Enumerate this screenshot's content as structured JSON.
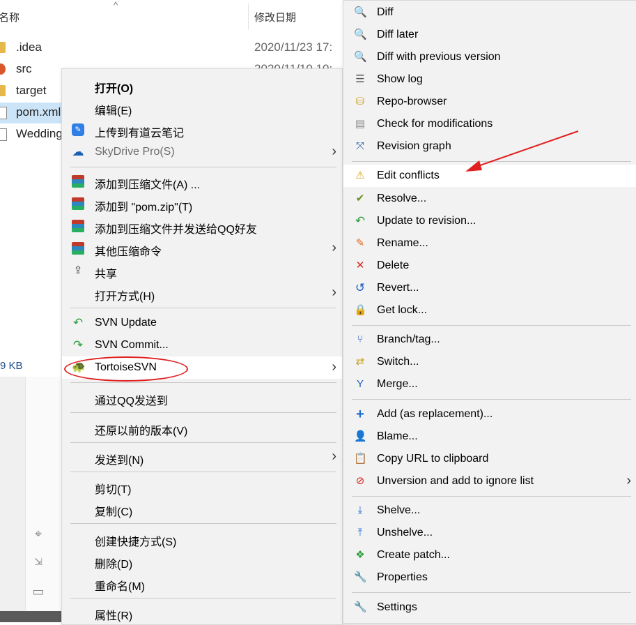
{
  "explorer": {
    "col_name": "名称",
    "col_date": "修改日期",
    "sort_arrow": "^",
    "files": [
      {
        "name": ".idea",
        "date": "2020/11/23 17:",
        "type": "folder"
      },
      {
        "name": "src",
        "date": "2020/11/10 10:",
        "type": "folder"
      },
      {
        "name": "target",
        "date": "",
        "type": "folder"
      },
      {
        "name": "pom.xml",
        "date": "",
        "type": "doc"
      },
      {
        "name": "Wedding",
        "date": "",
        "type": "doc"
      }
    ],
    "size_text": "9 KB"
  },
  "main_menu": {
    "items": [
      {
        "label": "打开(O)",
        "icon": "",
        "bold": true
      },
      {
        "label": "编辑(E)",
        "icon": ""
      },
      {
        "label": "上传到有道云笔记",
        "icon": "youdao-note-icon"
      },
      {
        "label": "SkyDrive Pro(S)",
        "icon": "cloud-icon",
        "disabled": true,
        "submenu": true
      },
      {
        "label": "添加到压缩文件(A) ...",
        "icon": "winrar-icon"
      },
      {
        "label": "添加到 \"pom.zip\"(T)",
        "icon": "winrar-icon"
      },
      {
        "label": "添加到压缩文件并发送给QQ好友",
        "icon": "winrar-icon"
      },
      {
        "label": "其他压缩命令",
        "icon": "winrar-icon",
        "submenu": true
      },
      {
        "label": "共享",
        "icon": "share-icon"
      },
      {
        "label": "打开方式(H)",
        "icon": "",
        "submenu": true
      },
      {
        "label": "SVN Update",
        "icon": "svn-update-icon"
      },
      {
        "label": "SVN Commit...",
        "icon": "svn-commit-icon"
      },
      {
        "label": "TortoiseSVN",
        "icon": "tortoisesvn-icon",
        "submenu": true,
        "highlight": true
      },
      {
        "label": "通过QQ发送到",
        "icon": ""
      },
      {
        "label": "还原以前的版本(V)",
        "icon": ""
      },
      {
        "label": "发送到(N)",
        "icon": "",
        "submenu": true
      },
      {
        "label": "剪切(T)",
        "icon": ""
      },
      {
        "label": "复制(C)",
        "icon": ""
      },
      {
        "label": "创建快捷方式(S)",
        "icon": ""
      },
      {
        "label": "删除(D)",
        "icon": ""
      },
      {
        "label": "重命名(M)",
        "icon": ""
      },
      {
        "label": "属性(R)",
        "icon": ""
      }
    ]
  },
  "svn_menu": {
    "items": [
      {
        "label": "Diff",
        "icon": "magnifier-icon"
      },
      {
        "label": "Diff later",
        "icon": "magnifier-icon"
      },
      {
        "label": "Diff with previous version",
        "icon": "magnifier-icon"
      },
      {
        "label": "Show log",
        "icon": "log-icon"
      },
      {
        "label": "Repo-browser",
        "icon": "repo-browser-icon"
      },
      {
        "label": "Check for modifications",
        "icon": "check-modifications-icon"
      },
      {
        "label": "Revision graph",
        "icon": "revision-graph-icon"
      },
      {
        "label": "Edit conflicts",
        "icon": "conflict-icon",
        "highlight": true
      },
      {
        "label": "Resolve...",
        "icon": "resolve-icon"
      },
      {
        "label": "Update to revision...",
        "icon": "update-icon"
      },
      {
        "label": "Rename...",
        "icon": "rename-icon"
      },
      {
        "label": "Delete",
        "icon": "delete-icon"
      },
      {
        "label": "Revert...",
        "icon": "revert-icon"
      },
      {
        "label": "Get lock...",
        "icon": "lock-icon"
      },
      {
        "label": "Branch/tag...",
        "icon": "branch-icon"
      },
      {
        "label": "Switch...",
        "icon": "switch-icon"
      },
      {
        "label": "Merge...",
        "icon": "merge-icon"
      },
      {
        "label": "Add (as replacement)...",
        "icon": "add-icon"
      },
      {
        "label": "Blame...",
        "icon": "blame-icon"
      },
      {
        "label": "Copy URL to clipboard",
        "icon": "copy-url-icon"
      },
      {
        "label": "Unversion and add to ignore list",
        "icon": "ignore-icon",
        "submenu": true
      },
      {
        "label": "Shelve...",
        "icon": "shelve-icon"
      },
      {
        "label": "Unshelve...",
        "icon": "unshelve-icon"
      },
      {
        "label": "Create patch...",
        "icon": "patch-icon"
      },
      {
        "label": "Properties",
        "icon": "properties-icon"
      },
      {
        "label": "Settings",
        "icon": "settings-icon"
      }
    ]
  },
  "colors": {
    "annotation_red": "#e02020",
    "menu_bg": "#f2f2f2",
    "highlight_bg": "#ffffff"
  }
}
